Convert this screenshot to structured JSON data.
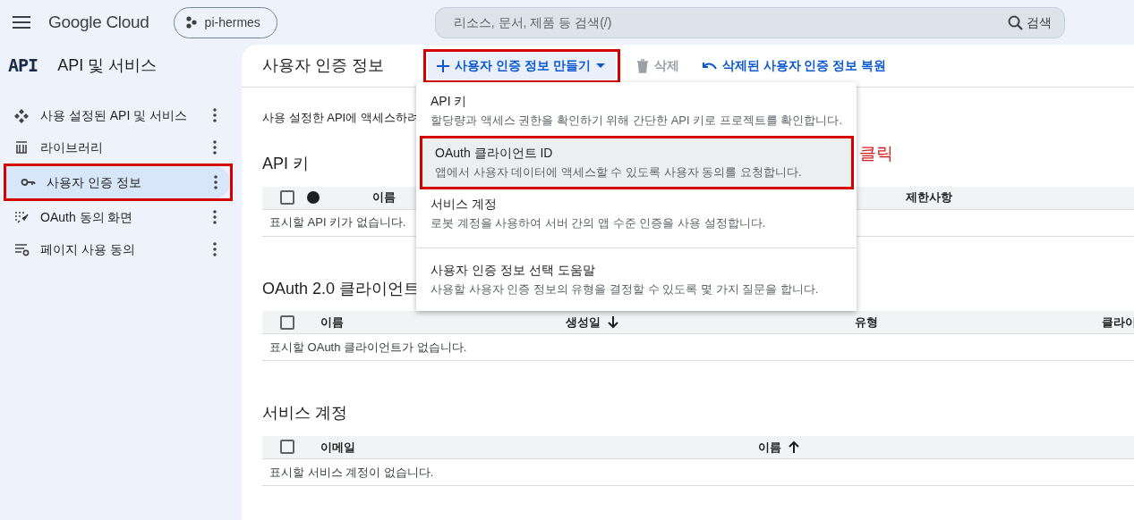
{
  "header": {
    "logo": "Google Cloud",
    "project": "pi-hermes",
    "search": {
      "placeholder": "리소스, 문서, 제품 등 검색(/)",
      "button": "검색"
    }
  },
  "sidebar": {
    "logo": "API",
    "title": "API 및 서비스",
    "items": [
      {
        "kind": "enabled",
        "label": "사용 설정된 API 및 서비스",
        "selected": false,
        "annotated": false
      },
      {
        "kind": "library",
        "label": "라이브러리",
        "selected": false,
        "annotated": false
      },
      {
        "kind": "credentials",
        "label": "사용자 인증 정보",
        "selected": true,
        "annotated": true
      },
      {
        "kind": "consent",
        "label": "OAuth 동의 화면",
        "selected": false,
        "annotated": false
      },
      {
        "kind": "agreement",
        "label": "페이지 사용 동의",
        "selected": false,
        "annotated": false
      }
    ]
  },
  "main": {
    "title": "사용자 인증 정보",
    "toolbar": [
      {
        "kind": "create",
        "label": "사용자 인증 정보 만들기",
        "disabled": false,
        "annotated": true
      },
      {
        "kind": "delete",
        "label": "삭제",
        "disabled": true,
        "annotated": false
      },
      {
        "kind": "restore",
        "label": "삭제된 사용자 인증 정보 복원",
        "disabled": false,
        "annotated": false
      }
    ],
    "description": "사용 설정한 API에 액세스하려",
    "sections": [
      {
        "title": "API 키",
        "columns": [
          {
            "kind": "checkbox",
            "checked": false
          },
          {
            "kind": "dot"
          },
          {
            "kind": "text",
            "label": "이름"
          },
          {
            "kind": "text",
            "label": "제한사항"
          }
        ],
        "empty": "표시할 API 키가 없습니다."
      },
      {
        "title": "OAuth 2.0 클라이언트",
        "columns": [
          {
            "kind": "checkbox",
            "checked": false
          },
          {
            "kind": "text",
            "label": "이름"
          },
          {
            "kind": "text",
            "label": "생성일",
            "sorted": true,
            "descending": true
          },
          {
            "kind": "text",
            "label": "유형"
          },
          {
            "kind": "text",
            "label": "클라이"
          }
        ],
        "empty": "표시할 OAuth 클라이언트가 없습니다."
      },
      {
        "title": "서비스 계정",
        "columns": [
          {
            "kind": "checkbox",
            "checked": false
          },
          {
            "kind": "text",
            "label": "이메일"
          },
          {
            "kind": "text",
            "label": "이름",
            "sorted": true,
            "descending": false
          }
        ],
        "empty": "표시할 서비스 계정이 없습니다."
      }
    ]
  },
  "menu": {
    "items": [
      {
        "title": "API 키",
        "description": "할당량과 액세스 권한을 확인하기 위해 간단한 API 키로 프로젝트를 확인합니다.",
        "selected": false,
        "annotated": false,
        "divider_before": false
      },
      {
        "title": "OAuth 클라이언트 ID",
        "description": "앱에서 사용자 데이터에 액세스할 수 있도록 사용자 동의를 요청합니다.",
        "selected": true,
        "annotated": true,
        "divider_before": false
      },
      {
        "title": "서비스 계정",
        "description": "로봇 계정을 사용하여 서버 간의 앱 수준 인증을 사용 설정합니다.",
        "selected": false,
        "annotated": false,
        "divider_before": false
      },
      {
        "title": "사용자 인증 정보 선택 도움말",
        "description": "사용할 사용자 인증 정보의 유형을 결정할 수 있도록 몇 가지 질문을 합니다.",
        "selected": false,
        "annotated": false,
        "divider_before": true
      }
    ]
  },
  "annotation_note": "클릭"
}
